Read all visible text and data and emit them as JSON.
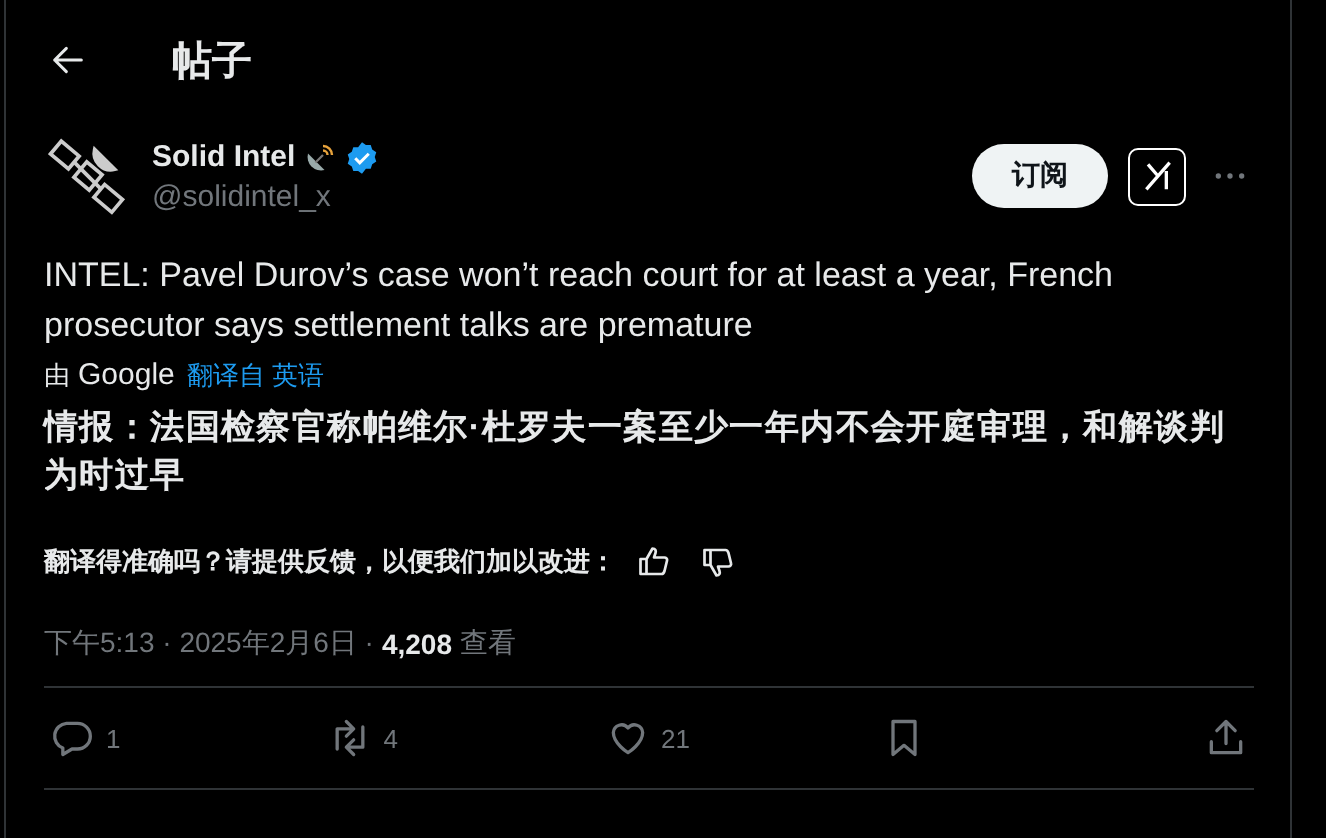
{
  "header": {
    "title": "帖子"
  },
  "author": {
    "name": "Solid Intel",
    "handle": "@solidintel_x",
    "verified": true
  },
  "subscribe_button": "订阅",
  "tweet_text": "INTEL: Pavel Durov’s case won’t reach court for at least a year, French prosecutor says settlement talks are premature",
  "translation": {
    "by": "由",
    "provider": "Google",
    "link": "翻译自 英语",
    "text": "情报：法国检察官称帕维尔·杜罗夫一案至少一年内不会开庭审理，和解谈判为时过早"
  },
  "feedback": "翻译得准确吗？请提供反馈，以便我们加以改进：",
  "meta": {
    "time": "下午5:13 · 2025年2月6日 ·",
    "views": "4,208",
    "views_label": "查看"
  },
  "actions": [
    {
      "kind": "reply",
      "count": "1"
    },
    {
      "kind": "repost",
      "count": "4"
    },
    {
      "kind": "like",
      "count": "21"
    },
    {
      "kind": "bookmark"
    },
    {
      "kind": "share"
    }
  ]
}
